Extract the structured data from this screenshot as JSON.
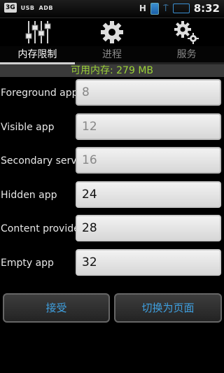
{
  "status_bar": {
    "network": "3G",
    "usb": "USB",
    "adb": "ADB",
    "signal_letter": "H",
    "time": "8:32"
  },
  "toolbar": {
    "icons": [
      "sliders-icon",
      "gear-icon",
      "gears-icon"
    ]
  },
  "tabs": [
    {
      "label": "内存限制",
      "active": true
    },
    {
      "label": "进程",
      "active": false
    },
    {
      "label": "服务",
      "active": false
    }
  ],
  "memory": {
    "label": "可用内存: 279 MB"
  },
  "limits": [
    {
      "label": "Foreground app",
      "value": "8",
      "enabled": false
    },
    {
      "label": "Visible app",
      "value": "12",
      "enabled": false
    },
    {
      "label": "Secondary server",
      "value": "16",
      "enabled": false
    },
    {
      "label": "Hidden app",
      "value": "24",
      "enabled": true
    },
    {
      "label": "Content provider",
      "value": "28",
      "enabled": true
    },
    {
      "label": "Empty app",
      "value": "32",
      "enabled": true
    }
  ],
  "actions": {
    "accept": "接受",
    "switch_page": "切换为页面"
  },
  "colors": {
    "accent_text": "#3fa0e0",
    "memory_text": "#9cd238"
  }
}
